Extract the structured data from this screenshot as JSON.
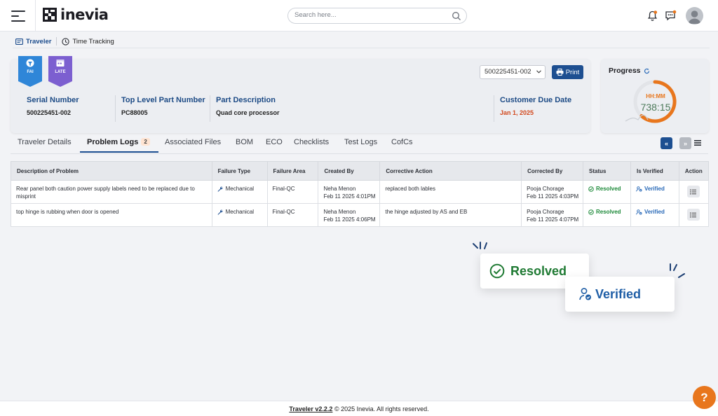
{
  "app": {
    "logo_text": "inevia"
  },
  "search": {
    "placeholder": "Search here..."
  },
  "subnav": {
    "traveler_label": "Traveler",
    "time_tracking_label": "Time Tracking"
  },
  "badges": {
    "fai": "FAI",
    "late": "LATE"
  },
  "header": {
    "serial_select_value": "500225451-002",
    "print_label": "Print",
    "fields": [
      {
        "label": "Serial Number",
        "value": "500225451-002"
      },
      {
        "label": "Top Level Part Number",
        "value": "PC88005"
      },
      {
        "label": "Part Description",
        "value": "Quad core processor"
      },
      {
        "label": "Customer Due Date",
        "value": "Jan 1, 2025"
      }
    ]
  },
  "progress": {
    "title": "Progress",
    "unit": "HH:MM",
    "value": "738:15"
  },
  "tabs": [
    {
      "label": "Traveler Details"
    },
    {
      "label": "Problem Logs",
      "count": "2"
    },
    {
      "label": "Associated Files"
    },
    {
      "label": "BOM"
    },
    {
      "label": "ECO"
    },
    {
      "label": "Checklists"
    },
    {
      "label": "Test Logs"
    },
    {
      "label": "CofCs"
    }
  ],
  "table": {
    "headers": [
      "Description of Problem",
      "Failure Type",
      "Failure Area",
      "Created By",
      "Corrective Action",
      "Corrected By",
      "Status",
      "Is Verified",
      "Action"
    ],
    "rows": [
      {
        "description": "Rear panel both caution power supply labels need to be replaced due to misprint",
        "failure_type": "Mechanical",
        "failure_area": "Final-QC",
        "created_by": "Neha Menon",
        "created_at": "Feb 11 2025 4:01PM",
        "corrective_action": "replaced both lables",
        "corrected_by": "Pooja Chorage",
        "corrected_at": "Feb 11 2025 4:03PM",
        "status": "Resolved",
        "verified": "Verified"
      },
      {
        "description": "top hinge is rubbing when door is opened",
        "failure_type": "Mechanical",
        "failure_area": "Final-QC",
        "created_by": "Neha Menon",
        "created_at": "Feb 11 2025 4:06PM",
        "corrective_action": "the hinge adjusted by AS and EB",
        "corrected_by": "Pooja Chorage",
        "corrected_at": "Feb 11 2025 4:07PM",
        "status": "Resolved",
        "verified": "Verified"
      }
    ]
  },
  "popups": {
    "resolved": "Resolved",
    "verified": "Verified"
  },
  "footer": {
    "version": "Traveler v2.2.2",
    "copyright": "© 2025 Inevia. All rights reserved."
  },
  "help": {
    "label": "?"
  },
  "colors": {
    "primary": "#1d4f91",
    "accent": "#e8761d",
    "resolved": "#1e8a3a",
    "verified": "#2a6ab8",
    "fai_badge": "#2f86d8",
    "late_badge": "#7c5fd0",
    "due_date": "#d2491e"
  }
}
